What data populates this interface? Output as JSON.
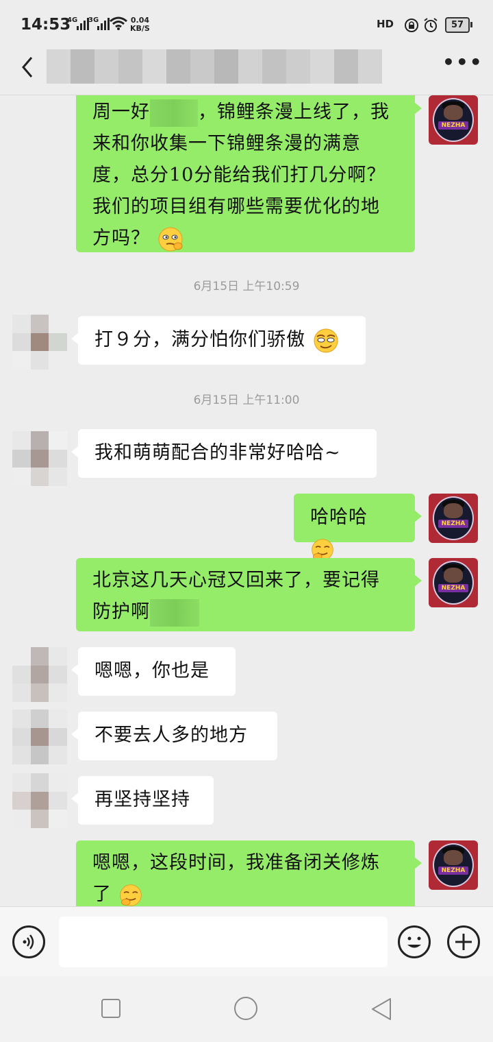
{
  "status_bar": {
    "time": "14:53",
    "signal1_label": "4G",
    "signal2_label": "3G",
    "net_speed_value": "0.04",
    "net_speed_unit": "KB/S",
    "hd_label": "HD",
    "battery": "57"
  },
  "header": {
    "back_icon": "chevron-left-icon",
    "more_icon": "more-dots-icon",
    "title_blurred": true
  },
  "messages": [
    {
      "from": "me",
      "text": "周一好",
      "text_after_blur": "，锦鲤条漫上线了，我来和你收集一下锦鲤条漫的满意度，总分10分能给我们打几分啊？我们的项目组有哪些需要优化的地方吗？",
      "emoji": "pondering-emoji"
    },
    {
      "type": "time",
      "text": "6月15日 上午10:59"
    },
    {
      "from": "them",
      "text": "打９分，满分怕你们骄傲",
      "emoji": "smirk-emoji"
    },
    {
      "type": "time",
      "text": "6月15日 上午11:00"
    },
    {
      "from": "them",
      "text": "我和萌萌配合的非常好哈哈~"
    },
    {
      "from": "me",
      "text": "哈哈哈",
      "emoji": "shy-laugh-emoji"
    },
    {
      "from": "me",
      "text": "北京这几天心冠又回来了，要记得防护啊"
    },
    {
      "from": "them",
      "text": "嗯嗯，你也是"
    },
    {
      "from": "them",
      "text": "不要去人多的地方"
    },
    {
      "from": "them",
      "text": "再坚持坚持"
    },
    {
      "from": "me",
      "text": "嗯嗯，这段时间，我准备闭关修炼了",
      "emoji": "shy-laugh-emoji"
    }
  ],
  "my_avatar_label": "NEZHA",
  "input_bar": {
    "voice_icon": "voice-icon",
    "emoji_icon": "smiley-icon",
    "plus_icon": "plus-icon",
    "input_value": ""
  },
  "nav_bar": {
    "recent_icon": "square-icon",
    "home_icon": "circle-icon",
    "back_icon": "triangle-back-icon"
  },
  "colors": {
    "my_bubble": "#95ec69",
    "their_bubble": "#ffffff",
    "background": "#ededed"
  }
}
